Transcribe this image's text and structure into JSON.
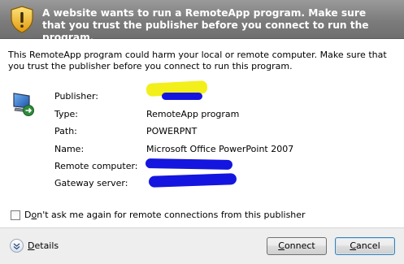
{
  "banner": {
    "title": "A website wants to run a RemoteApp program. Make sure that you trust the publisher before you connect to run the program."
  },
  "warning_text": "This RemoteApp program could harm your local or remote computer. Make sure that you trust the publisher before you connect to run this program.",
  "details": {
    "publisher": {
      "label": "Publisher:",
      "value": ""
    },
    "type": {
      "label": "Type:",
      "value": "RemoteApp program"
    },
    "path": {
      "label": "Path:",
      "value": "POWERPNT"
    },
    "name": {
      "label": "Name:",
      "value": "Microsoft Office PowerPoint 2007"
    },
    "remote_computer": {
      "label": "Remote computer:",
      "value": ""
    },
    "gateway_server": {
      "label": "Gateway server:",
      "value": ""
    }
  },
  "dont_ask": {
    "prefix": "D",
    "accel": "o",
    "suffix": "n't ask me again for remote connections from this publisher",
    "checked": false
  },
  "footer": {
    "details_accel": "D",
    "details_rest": "etails",
    "connect_accel": "C",
    "connect_rest": "onnect",
    "cancel_accel": "C",
    "cancel_rest": "ancel"
  },
  "icons": {
    "banner": "security-shield-warning-icon",
    "app": "remoteapp-computer-icon",
    "details": "chevron-down-icon"
  },
  "colors": {
    "banner_bg": "#7c7c7c",
    "redaction_blue": "#1515e0",
    "redaction_yellow": "#f2ef1a",
    "default_button_border": "#3c7fb1"
  }
}
